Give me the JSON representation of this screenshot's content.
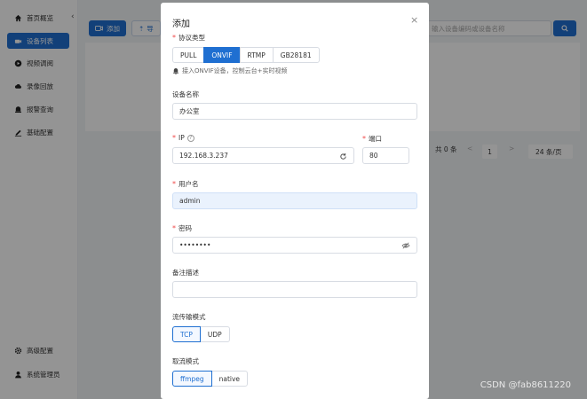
{
  "sidebar": {
    "items": [
      {
        "label": "首页概览",
        "icon": "home-icon"
      },
      {
        "label": "设备列表",
        "icon": "camera-icon",
        "active": true
      },
      {
        "label": "视频调阅",
        "icon": "play-circle-icon"
      },
      {
        "label": "录像回放",
        "icon": "cloud-icon"
      },
      {
        "label": "报警查询",
        "icon": "alarm-icon"
      },
      {
        "label": "基础配置",
        "icon": "edit-icon"
      }
    ],
    "bottom_items": [
      {
        "label": "高级配置",
        "icon": "gear-icon"
      },
      {
        "label": "系统管理员",
        "icon": "user-icon"
      }
    ]
  },
  "background": {
    "add_label": "添加",
    "import_label": "导",
    "search_placeholder": "输入设备编码或设备名称",
    "pager": {
      "total": "共 0 条",
      "prev": "<",
      "page": "1",
      "next": ">",
      "page_size": "24 条/页"
    }
  },
  "dialog": {
    "title": "添加",
    "close": "×",
    "protocol": {
      "label": "协议类型",
      "options": [
        "PULL",
        "ONVIF",
        "RTMP",
        "GB28181"
      ],
      "selected": "ONVIF",
      "hint": "接入ONVIF设备，控制云台+实时视频"
    },
    "device_name": {
      "label": "设备名称",
      "value": "办公室"
    },
    "ip": {
      "label": "IP",
      "value": "192.168.3.237"
    },
    "port": {
      "label": "端口",
      "value": "80"
    },
    "username": {
      "label": "用户名",
      "value": "admin"
    },
    "password": {
      "label": "密码",
      "value": "••••••••"
    },
    "remark": {
      "label": "备注描述",
      "value": ""
    },
    "transport": {
      "label": "流传输模式",
      "options": [
        "TCP",
        "UDP"
      ],
      "selected": "TCP"
    },
    "pull_mode": {
      "label": "取流模式",
      "options": [
        "ffmpeg",
        "native"
      ],
      "selected": "ffmpeg"
    }
  },
  "watermark": "CSDN @fab8611220",
  "colors": {
    "primary": "#1f6fd1",
    "required": "#f04848",
    "overlay": "rgba(0,0,0,0.42)"
  }
}
